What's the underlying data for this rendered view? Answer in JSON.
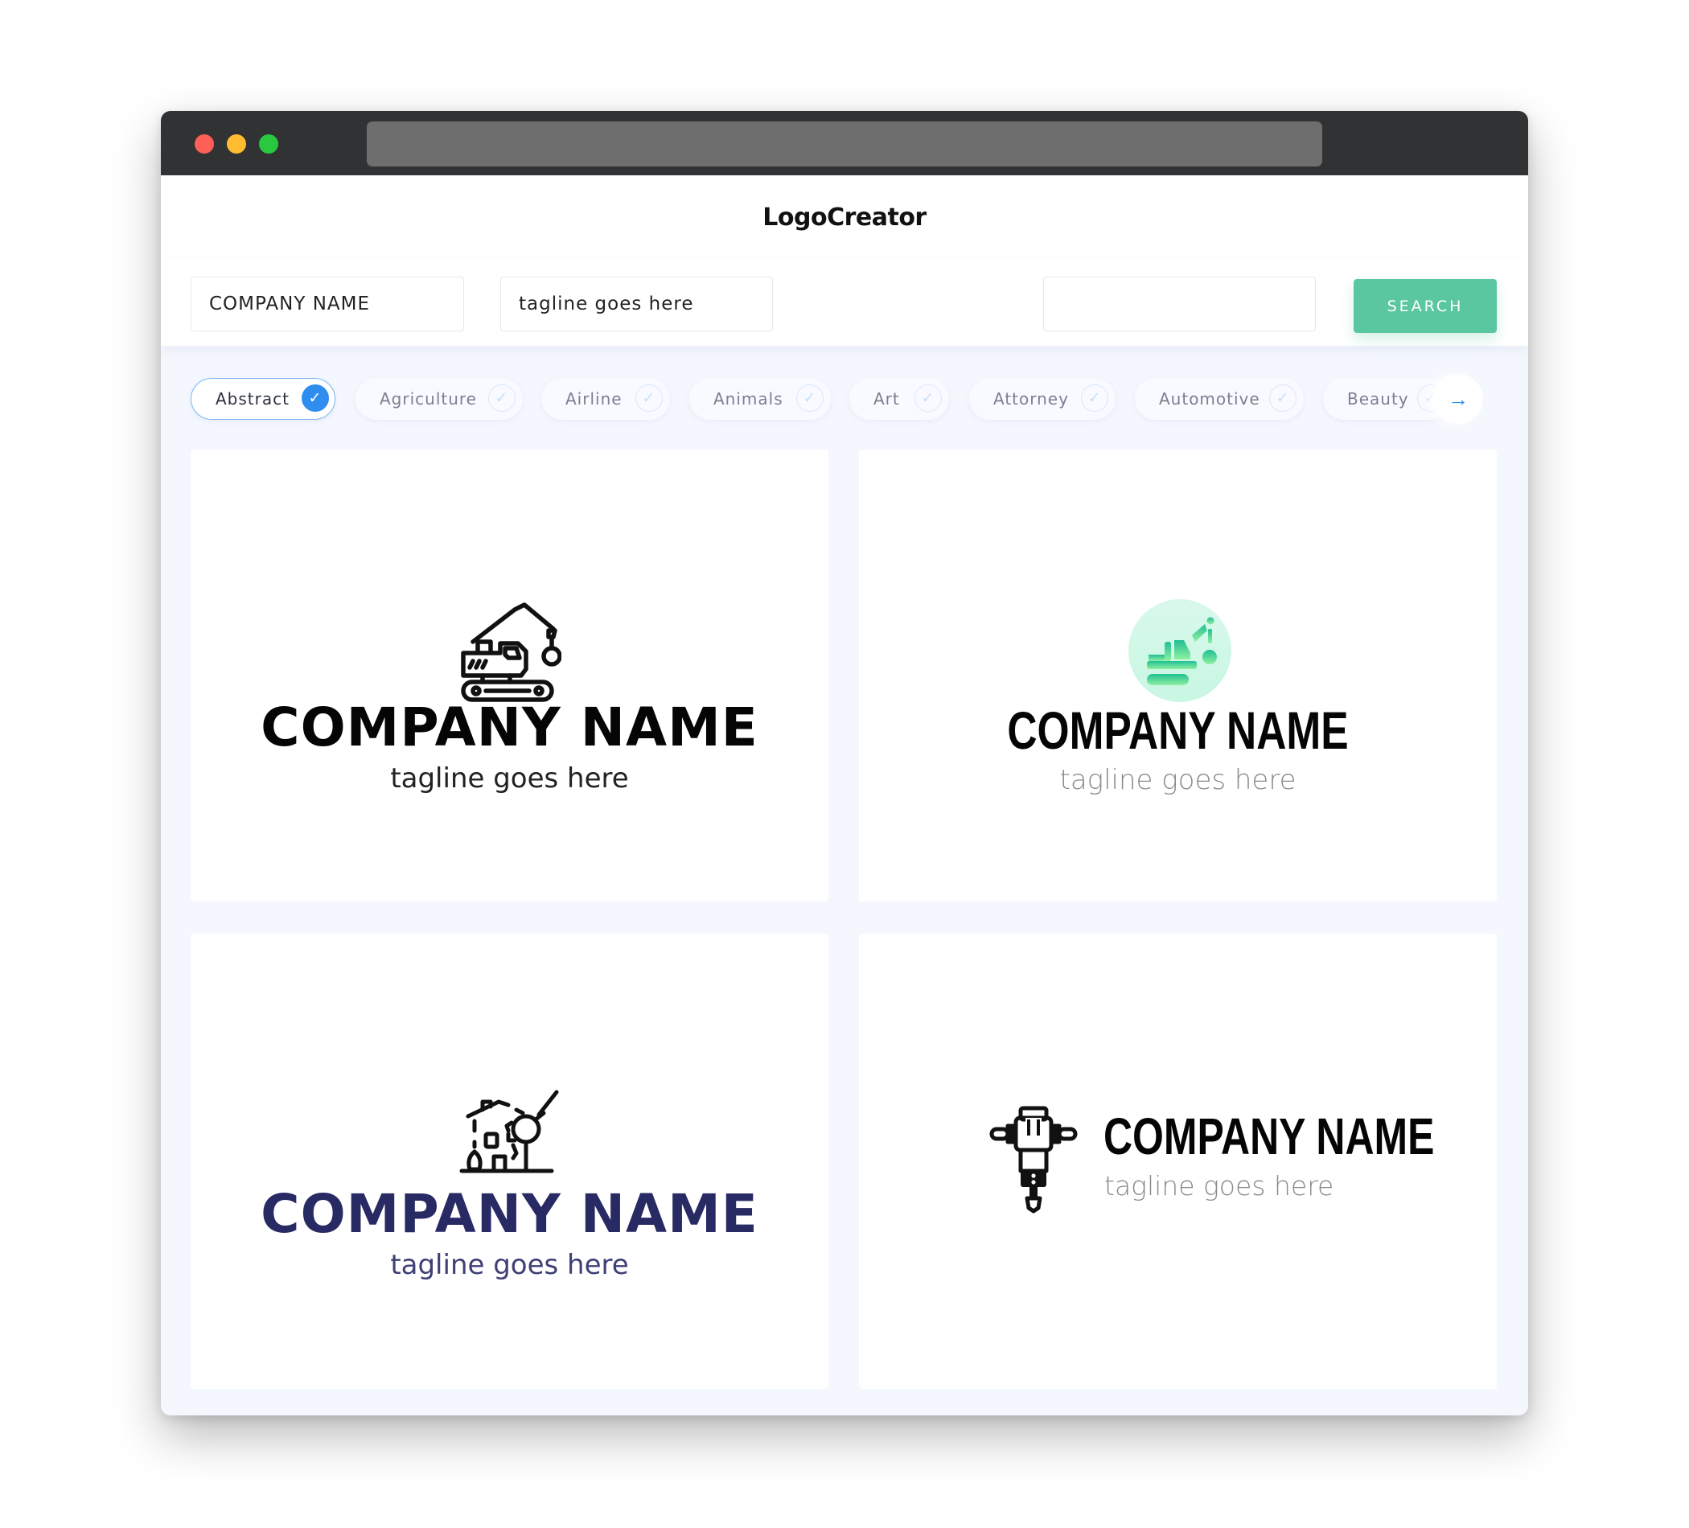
{
  "window": {
    "controls": [
      "close",
      "minimize",
      "maximize"
    ],
    "url": ""
  },
  "header": {
    "title": "LogoCreator"
  },
  "form": {
    "company_value": "COMPANY NAME",
    "tagline_value": "tagline goes here",
    "search_value": "",
    "search_placeholder": "",
    "search_label": "SEARCH"
  },
  "categories": [
    {
      "label": "Abstract",
      "selected": true
    },
    {
      "label": "Agriculture",
      "selected": false
    },
    {
      "label": "Airline",
      "selected": false
    },
    {
      "label": "Animals",
      "selected": false
    },
    {
      "label": "Art",
      "selected": false
    },
    {
      "label": "Attorney",
      "selected": false
    },
    {
      "label": "Automotive",
      "selected": false
    },
    {
      "label": "Beauty",
      "selected": false
    }
  ],
  "icons": {
    "check": "✓",
    "next": "→"
  },
  "logos": [
    {
      "icon": "wrecking-crane-outline-icon",
      "company": "COMPANY NAME",
      "tagline": "tagline goes here",
      "text_color": "#050505",
      "layout": "stacked"
    },
    {
      "icon": "wrecking-crane-gradient-circle-icon",
      "company": "COMPANY NAME",
      "tagline": "tagline goes here",
      "text_color": "#050505",
      "accent": "#2fc79a",
      "layout": "stacked"
    },
    {
      "icon": "house-wrecking-ball-icon",
      "company": "COMPANY NAME",
      "tagline": "tagline goes here",
      "text_color": "#282a63",
      "layout": "stacked"
    },
    {
      "icon": "jackhammer-icon",
      "company": "COMPANY NAME",
      "tagline": "tagline goes here",
      "text_color": "#050505",
      "layout": "inline"
    }
  ],
  "colors": {
    "search_button": "#5bc7a0",
    "selected_chip": "#2f8df0",
    "page_bg": "#f4f7fd",
    "titlebar": "#313234"
  }
}
